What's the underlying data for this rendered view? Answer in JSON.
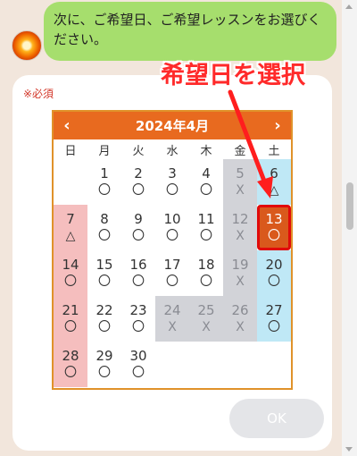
{
  "chat": {
    "message": "次に、ご希望日、ご希望レッスンをお選びください。"
  },
  "form": {
    "required_label": "※必須",
    "ok_label": "OK"
  },
  "calendar": {
    "title": "2024年4月",
    "prev": "‹",
    "next": "›",
    "weekdays": [
      "日",
      "月",
      "火",
      "水",
      "木",
      "金",
      "土"
    ],
    "weeks": [
      [
        null,
        {
          "day": "1",
          "mark": "〇"
        },
        {
          "day": "2",
          "mark": "〇"
        },
        {
          "day": "3",
          "mark": "〇"
        },
        {
          "day": "4",
          "mark": "〇"
        },
        {
          "day": "5",
          "mark": "X",
          "state": "na"
        },
        {
          "day": "6",
          "mark": "△",
          "state": "sat"
        }
      ],
      [
        {
          "day": "7",
          "mark": "△",
          "state": "sun"
        },
        {
          "day": "8",
          "mark": "〇"
        },
        {
          "day": "9",
          "mark": "〇"
        },
        {
          "day": "10",
          "mark": "〇"
        },
        {
          "day": "11",
          "mark": "〇"
        },
        {
          "day": "12",
          "mark": "X",
          "state": "na"
        },
        {
          "day": "13",
          "mark": "〇",
          "state": "sel"
        }
      ],
      [
        {
          "day": "14",
          "mark": "〇",
          "state": "sun"
        },
        {
          "day": "15",
          "mark": "〇"
        },
        {
          "day": "16",
          "mark": "〇"
        },
        {
          "day": "17",
          "mark": "〇"
        },
        {
          "day": "18",
          "mark": "〇"
        },
        {
          "day": "19",
          "mark": "X",
          "state": "na"
        },
        {
          "day": "20",
          "mark": "〇",
          "state": "sat"
        }
      ],
      [
        {
          "day": "21",
          "mark": "〇",
          "state": "sun"
        },
        {
          "day": "22",
          "mark": "〇"
        },
        {
          "day": "23",
          "mark": "〇"
        },
        {
          "day": "24",
          "mark": "X",
          "state": "na"
        },
        {
          "day": "25",
          "mark": "X",
          "state": "na"
        },
        {
          "day": "26",
          "mark": "X",
          "state": "na"
        },
        {
          "day": "27",
          "mark": "〇",
          "state": "sat"
        }
      ],
      [
        {
          "day": "28",
          "mark": "〇",
          "state": "sun"
        },
        {
          "day": "29",
          "mark": "〇"
        },
        {
          "day": "30",
          "mark": "〇"
        },
        null,
        null,
        null,
        null
      ]
    ]
  },
  "annotation": {
    "text": "希望日を選択",
    "color": "#ff2a2a"
  },
  "colors": {
    "accent": "#e86a1f",
    "selected": "#d9591c",
    "bubble": "#a6de6d"
  }
}
